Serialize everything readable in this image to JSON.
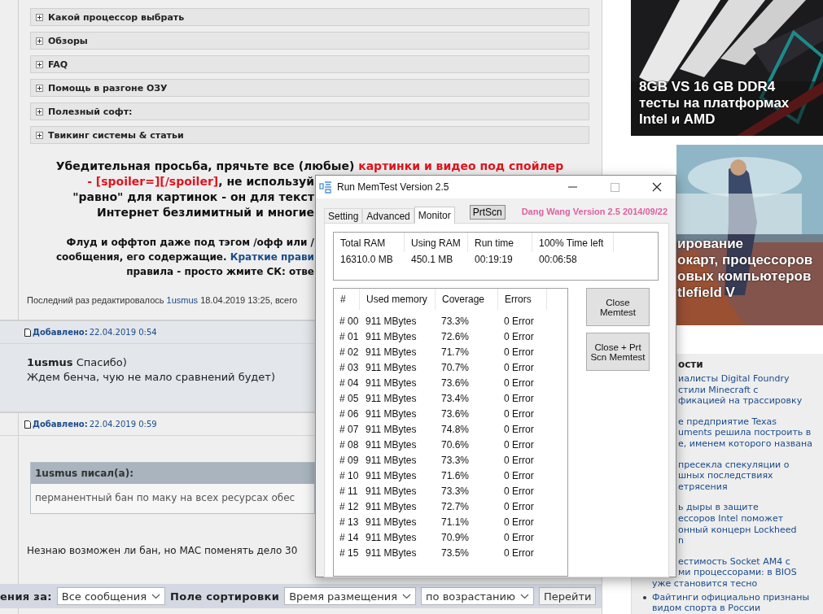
{
  "forum": {
    "sections": [
      {
        "label": "Какой процессор выбрать",
        "expanded": false
      },
      {
        "label": "Обзоры",
        "expanded": false
      },
      {
        "label": "FAQ",
        "expanded": false
      },
      {
        "label": "Помощь в разгоне ОЗУ",
        "expanded": false
      },
      {
        "label": "Полезный софт:",
        "expanded": false
      },
      {
        "label": "Твикинг системы & статьи",
        "expanded": false
      }
    ],
    "notice": [
      {
        "clipped": false,
        "parts": [
          {
            "text": "Убедительная просьба, прячьте все (любые) ",
            "highlight": false
          },
          {
            "text": "картинки и видео под спойлер",
            "highlight": true
          }
        ]
      },
      {
        "clipped": true,
        "parts": [
          {
            "text": "- [spoiler=][/spoiler]",
            "highlight": true
          },
          {
            "text": ", не используй",
            "highlight": false
          }
        ]
      },
      {
        "clipped": true,
        "parts": [
          {
            "text": "\"равно\" для картинок - он для текст",
            "highlight": false
          }
        ]
      },
      {
        "clipped": true,
        "parts": [
          {
            "text": "Интернет безлимитный и многие",
            "highlight": false
          }
        ]
      }
    ],
    "rules": [
      {
        "clipped": true,
        "parts": [
          {
            "text": "Флуд и оффтоп даже под тэгом /офф или /",
            "kind": "plain"
          }
        ]
      },
      {
        "clipped": true,
        "parts": [
          {
            "text": "сообщения, его содержащие. ",
            "kind": "plain"
          },
          {
            "text": "Краткие прави",
            "kind": "link"
          }
        ]
      },
      {
        "clipped": true,
        "parts": [
          {
            "text": "правила - просто жмите СК: отве",
            "kind": "plain"
          }
        ]
      }
    ],
    "edit_note": {
      "prefix": "Последний раз редактировалось ",
      "user": "1usmus",
      "suffix": " 18.04.2019 13:25, всего"
    },
    "posts": [
      {
        "added_label": "Добавлено:",
        "date": "22.04.2019 0:54",
        "highlighted": true,
        "blocks": [
          {
            "kind": "text",
            "text": "**1usmus** Спасибо)"
          },
          {
            "kind": "text",
            "text": "Ждем бенча, чую не мало сравнений будет)"
          }
        ]
      },
      {
        "added_label": "Добавлено:",
        "date": "22.04.2019 0:59",
        "highlighted": false,
        "blocks": [
          {
            "kind": "quote",
            "author": "1usmus писал(а):",
            "text": "перманентный бан по маку на всех ресурсах обес"
          },
          {
            "kind": "text",
            "text": "Незнаю возможен ли бан, но MAC поменять дело 30"
          }
        ]
      }
    ],
    "bottom_bar": {
      "label": "ения за:",
      "period": "Все сообщения",
      "sort_label": "Поле сортировки",
      "sort_field": "Время размещения",
      "order": "по возрастанию",
      "button": "Перейти"
    }
  },
  "sidebar": {
    "ads": [
      {
        "kind": "picture",
        "lines": [
          {
            "text": "8GB VS 16 GB DDR4",
            "clipped": false
          },
          {
            "text": "тесты на платформах",
            "clipped": false
          },
          {
            "text": "Intel и AMD",
            "clipped": false
          }
        ]
      },
      {
        "kind": "picture",
        "lines": [
          {
            "text": "ирование",
            "clipped": true
          },
          {
            "text": "окарт, процессоров",
            "clipped": true
          },
          {
            "text": "овых компьютеров",
            "clipped": true
          },
          {
            "text": "tlefield V",
            "clipped": true
          }
        ]
      }
    ],
    "news": {
      "heading": "ости",
      "items": [
        {
          "bullet": false,
          "lines": [
            {
              "text": "иалисты Digital Foundry",
              "clipped": true
            },
            {
              "text": "стили Minecraft с",
              "clipped": true
            },
            {
              "text": "фикацией на трассировку",
              "clipped": true
            }
          ]
        },
        {
          "bullet": false,
          "lines": [
            {
              "text": "е предприятие Texas",
              "clipped": true
            },
            {
              "text": "uments решила построить в",
              "clipped": true
            },
            {
              "text": "е, именем которого названа",
              "clipped": true
            }
          ]
        },
        {
          "bullet": false,
          "lines": [
            {
              "text": "пресекла спекуляции о",
              "clipped": true
            },
            {
              "text": "шных последствиях",
              "clipped": true
            },
            {
              "text": "етрясения",
              "clipped": true
            }
          ]
        },
        {
          "bullet": false,
          "lines": [
            {
              "text": "ь дыры в защите",
              "clipped": true
            },
            {
              "text": "ессоров Intel поможет",
              "clipped": true
            },
            {
              "text": "онный концерн Lockheed",
              "clipped": true
            },
            {
              "text": "n",
              "clipped": true
            }
          ]
        },
        {
          "bullet": false,
          "lines": [
            {
              "text": "естимость Socket AM4 с",
              "clipped": true
            },
            {
              "text": "ми процессорами: в BIOS",
              "clipped": true
            },
            {
              "text": "уже становится тесно",
              "clipped": false
            }
          ]
        },
        {
          "bullet": true,
          "lines": [
            {
              "text": "Файтинги официально признаны",
              "clipped": false
            },
            {
              "text": "видом спорта в России",
              "clipped": false
            }
          ]
        }
      ]
    }
  },
  "window": {
    "title": "Run MemTest Version 2.5",
    "tabs": [
      {
        "label": "Setting",
        "selected": false
      },
      {
        "label": "Advanced",
        "selected": false
      },
      {
        "label": "Monitor",
        "selected": true
      }
    ],
    "prtscn": "PrtScn",
    "credit": "Dang Wang Version 2.5 2014/09/22",
    "stats": {
      "columns": [
        "Total RAM",
        "Using RAM",
        "Run time",
        "100% Time left"
      ],
      "values": [
        "16310.0 MB",
        "450.1 MB",
        "00:19:19",
        "00:06:58"
      ]
    },
    "table": {
      "columns": [
        "#",
        "Used memory",
        "Coverage",
        "Errors"
      ],
      "rows": [
        [
          "# 00",
          "911 MBytes",
          "73.3%",
          "0 Error"
        ],
        [
          "# 01",
          "911 MBytes",
          "72.6%",
          "0 Error"
        ],
        [
          "# 02",
          "911 MBytes",
          "71.7%",
          "0 Error"
        ],
        [
          "# 03",
          "911 MBytes",
          "70.7%",
          "0 Error"
        ],
        [
          "# 04",
          "911 MBytes",
          "73.6%",
          "0 Error"
        ],
        [
          "# 05",
          "911 MBytes",
          "73.4%",
          "0 Error"
        ],
        [
          "# 06",
          "911 MBytes",
          "73.6%",
          "0 Error"
        ],
        [
          "# 07",
          "911 MBytes",
          "74.8%",
          "0 Error"
        ],
        [
          "# 08",
          "911 MBytes",
          "70.6%",
          "0 Error"
        ],
        [
          "# 09",
          "911 MBytes",
          "73.3%",
          "0 Error"
        ],
        [
          "# 10",
          "911 MBytes",
          "71.6%",
          "0 Error"
        ],
        [
          "# 11",
          "911 MBytes",
          "73.3%",
          "0 Error"
        ],
        [
          "# 12",
          "911 MBytes",
          "72.7%",
          "0 Error"
        ],
        [
          "# 13",
          "911 MBytes",
          "71.1%",
          "0 Error"
        ],
        [
          "# 14",
          "911 MBytes",
          "70.9%",
          "0 Error"
        ],
        [
          "# 15",
          "911 MBytes",
          "73.5%",
          "0 Error"
        ]
      ]
    },
    "buttons": [
      "Close Memtest",
      "Close + Prt Scn Memtest"
    ]
  }
}
